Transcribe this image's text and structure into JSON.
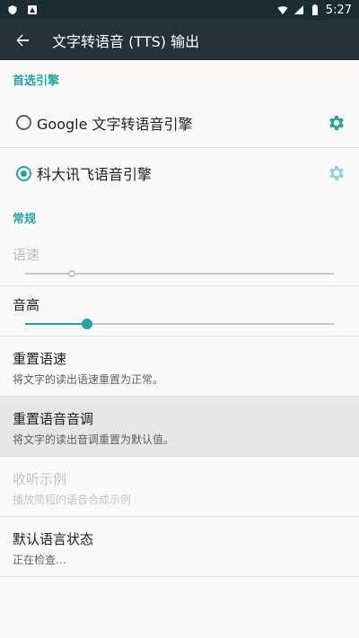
{
  "status": {
    "time": "5:27"
  },
  "toolbar": {
    "title": "文字转语音 (TTS) 输出"
  },
  "preferred_engine": {
    "header": "首选引擎",
    "engines": [
      {
        "label": "Google 文字转语音引擎",
        "selected": false
      },
      {
        "label": "科大讯飞语音引擎",
        "selected": true
      }
    ]
  },
  "general": {
    "header": "常规",
    "speech_rate": {
      "label": "语速",
      "value": 0.15,
      "enabled": false
    },
    "pitch": {
      "label": "音高",
      "value": 0.2,
      "enabled": true
    },
    "items": [
      {
        "label": "重置语速",
        "summary": "将文字的读出语速重置为正常。"
      },
      {
        "label": "重置语音音调",
        "summary": "将文字的读出音调重置为默认值。"
      },
      {
        "label": "收听示例",
        "summary": "播放简短的语音合成示例"
      },
      {
        "label": "默认语言状态",
        "summary": "正在检查…"
      }
    ]
  },
  "colors": {
    "accent": "#26a69a",
    "toolbar": "#263238"
  }
}
